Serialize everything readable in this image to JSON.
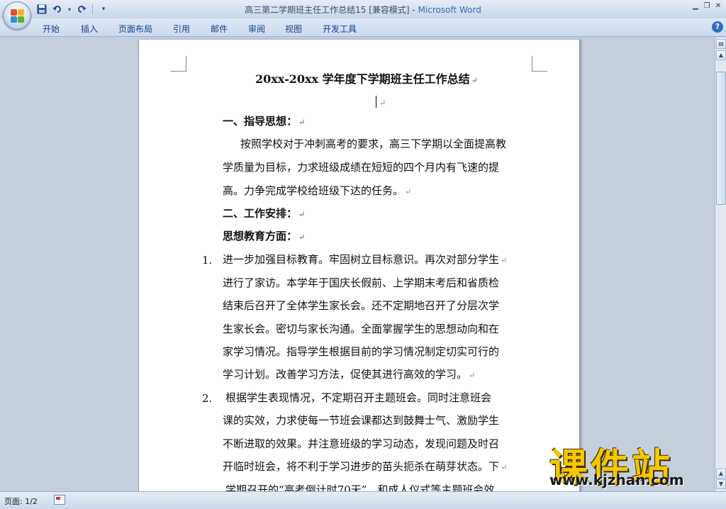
{
  "window": {
    "title": "高三第二学期班主任工作总结15 [兼容模式] - ",
    "app_name": "Microsoft Word"
  },
  "tabs": [
    "开始",
    "插入",
    "页面布局",
    "引用",
    "邮件",
    "审阅",
    "视图",
    "开发工具"
  ],
  "document": {
    "title": "20xx-20xx 学年度下学期班主任工作总结",
    "lines": [
      {
        "text": "一、指导思想：",
        "bold": true
      },
      {
        "text": "按照学校对于冲刺高考的要求，高三下学期以全面提高教",
        "bold": false
      },
      {
        "text": "学质量为目标，力求班级成绩在短短的四个月内有飞速的提",
        "bold": false
      },
      {
        "text": "高。力争完成学校给班级下达的任务。",
        "bold": false
      },
      {
        "text": "二、工作安排：",
        "bold": true
      },
      {
        "text": "思想教育方面：",
        "bold": true
      }
    ],
    "list": [
      {
        "num": "1.",
        "lines": [
          "进一步加强目标教育。牢固树立目标意识。再次对部分学生",
          "进行了家访。本学年于国庆长假前、上学期末考后和省质检",
          "结束后召开了全体学生家长会。还不定期地召开了分层次学",
          "生家长会。密切与家长沟通。全面掌握学生的思想动向和在",
          "家学习情况。指导学生根据目前的学习情况制定切实可行的",
          "学习计划。改善学习方法，促使其进行高效的学习。"
        ]
      },
      {
        "num": "2.",
        "lines": [
          "根据学生表现情况，不定期召开主题班会。同时注意班会",
          "课的实效，力求使每一节班会课都达到鼓舞士气、激励学生",
          "不断进取的效果。并注意班级的学习动态，发现问题及时召",
          "开临时班会，将不利于学习进步的苗头扼杀在萌芽状态。下",
          "学期召开的“高考倒计时70天”、和成人仪式等主题班会效"
        ]
      }
    ],
    "paragraph_mark": "↵"
  },
  "status": {
    "page": "页面: 1/2"
  },
  "watermark": {
    "text": "课件站",
    "url": "www.kjzhan.com"
  },
  "icons": {
    "office_button": "office-logo-icon",
    "save": "save-icon",
    "undo": "undo-icon",
    "redo": "redo-icon",
    "help": "help-icon"
  }
}
